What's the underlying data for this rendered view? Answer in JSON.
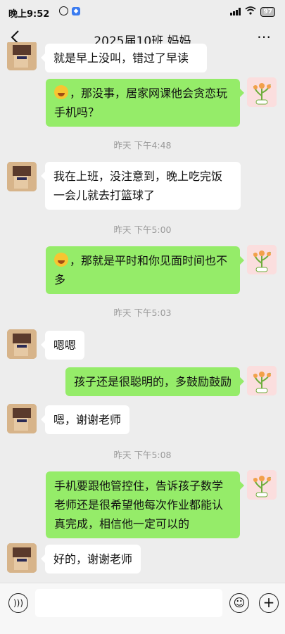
{
  "status_bar": {
    "time": "晚上9:52",
    "battery": "97"
  },
  "header": {
    "title": "2025届10班 妈妈"
  },
  "messages": {
    "m0": {
      "text": "就是早上没叫，错过了早读"
    },
    "m1": {
      "text": "，那没事，居家网课他会贪恋玩手机吗？"
    },
    "t1": {
      "text": "昨天 下午4:48"
    },
    "m2": {
      "text": "我在上班，没注意到，晚上吃完饭一会儿就去打篮球了"
    },
    "t2": {
      "text": "昨天 下午5:00"
    },
    "m3": {
      "text": "，那就是平时和你见面时间也不多"
    },
    "t3": {
      "text": "昨天 下午5:03"
    },
    "m4": {
      "text": "嗯嗯"
    },
    "m5": {
      "text": "孩子还是很聪明的，多鼓励鼓励"
    },
    "m6": {
      "text": "嗯，谢谢老师"
    },
    "t4": {
      "text": "昨天 下午5:08"
    },
    "m7": {
      "text": "手机要跟他管控住，告诉孩子数学老师还是很希望他每次作业都能认真完成，相信他一定可以的"
    },
    "m8": {
      "text": "好的，谢谢老师"
    }
  },
  "colors": {
    "outgoing_bubble": "#95ec69",
    "incoming_bubble": "#ffffff",
    "background": "#ededed"
  }
}
